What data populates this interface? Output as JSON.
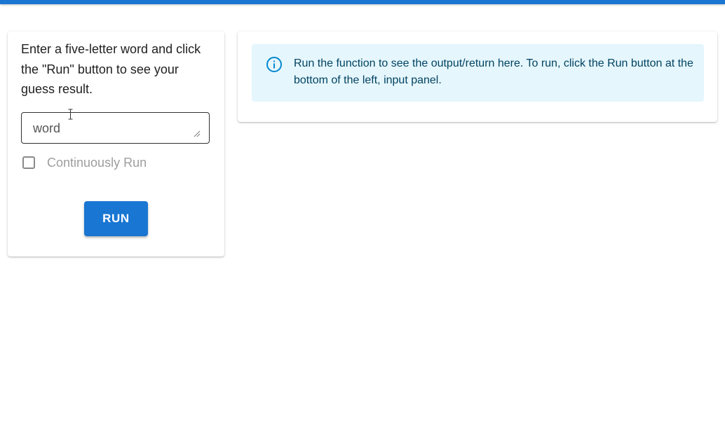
{
  "colors": {
    "accent": "#1976d2",
    "info_background": "#e5f6fd",
    "info_text": "#014361",
    "info_icon": "#0288d1"
  },
  "left_panel": {
    "instructions": "Enter a five-letter word and click the \"Run\" button to see your guess result.",
    "word_input": {
      "placeholder": "word",
      "value": ""
    },
    "continuous_run": {
      "label": "Continuously Run",
      "checked": false
    },
    "run_label": "RUN"
  },
  "right_panel": {
    "info_icon": "info-circle-icon",
    "info_message": "Run the function to see the output/return here. To run, click the Run button at the bottom of the left, input panel."
  }
}
